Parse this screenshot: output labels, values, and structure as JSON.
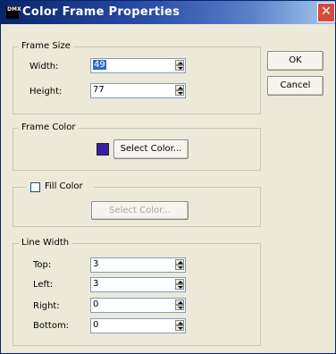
{
  "window": {
    "icon_text": "DMX",
    "title": "Color Frame Properties",
    "close_glyph": "✕"
  },
  "frame_size": {
    "label": "Frame Size",
    "width_label": "Width:",
    "width_value": "49",
    "height_label": "Height:",
    "height_value": "77"
  },
  "frame_color": {
    "label": "Frame Color",
    "swatch_color": "#3A1FA0",
    "button_label": "Select Color..."
  },
  "fill_color": {
    "label": "Fill Color",
    "checked": false,
    "button_label": "Select Color..."
  },
  "line_width": {
    "label": "Line Width",
    "top_label": "Top:",
    "top_value": "3",
    "left_label": "Left:",
    "left_value": "3",
    "right_label": "Right:",
    "right_value": "0",
    "bottom_label": "Bottom:",
    "bottom_value": "0"
  },
  "buttons": {
    "ok": "OK",
    "cancel": "Cancel"
  }
}
